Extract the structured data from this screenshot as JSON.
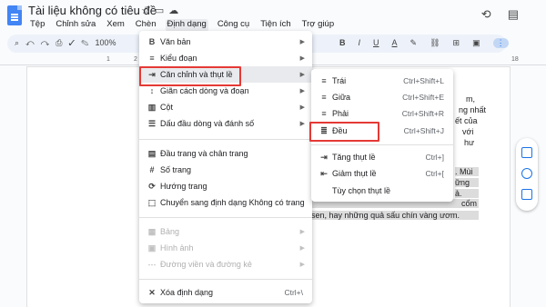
{
  "doc": {
    "title": "Tài liệu không có tiêu đề",
    "menus": [
      "Tệp",
      "Chỉnh sửa",
      "Xem",
      "Chèn",
      "Định dạng",
      "Công cụ",
      "Tiện ích",
      "Trợ giúp"
    ],
    "zoom": "100%"
  },
  "ruler": [
    "1",
    "2",
    "18"
  ],
  "body_text": {
    "l1": "m,",
    "l2": "ng nhất",
    "l3": "ết của",
    "l4": "với",
    "l5": "hư",
    "l6": ". Mùi",
    "l7": "ững",
    "l8": "ả.",
    "l9": "cốm",
    "l10": "sen, hay những quả sấu chín vàng ươm."
  },
  "format_menu": {
    "items": [
      {
        "label": "Văn bản",
        "icon": "bold-icon"
      },
      {
        "label": "Kiểu đoạn",
        "icon": "paragraph-style-icon"
      },
      {
        "label": "Căn chỉnh và thụt lề",
        "icon": "align-indent-icon"
      },
      {
        "label": "Giãn cách dòng và đoạn",
        "icon": "line-spacing-icon"
      },
      {
        "label": "Cột",
        "icon": "columns-icon"
      },
      {
        "label": "Dấu đầu dòng và đánh số",
        "icon": "bullets-icon"
      },
      {
        "label": "Đầu trang và chân trang",
        "icon": "header-footer-icon"
      },
      {
        "label": "Số trang",
        "icon": "page-number-icon"
      },
      {
        "label": "Hướng trang",
        "icon": "orientation-icon"
      },
      {
        "label": "Chuyển sang định dạng Không có trang",
        "icon": "pageless-icon"
      },
      {
        "label": "Bảng",
        "icon": "table-icon"
      },
      {
        "label": "Hình ảnh",
        "icon": "image-icon"
      },
      {
        "label": "Đường viền và đường kẻ",
        "icon": "borders-icon"
      },
      {
        "label": "Xóa định dạng",
        "icon": "clear-format-icon",
        "shortcut": "Ctrl+\\"
      }
    ]
  },
  "align_menu": {
    "items": [
      {
        "label": "Trái",
        "shortcut": "Ctrl+Shift+L"
      },
      {
        "label": "Giữa",
        "shortcut": "Ctrl+Shift+E"
      },
      {
        "label": "Phải",
        "shortcut": "Ctrl+Shift+R"
      },
      {
        "label": "Đều",
        "shortcut": "Ctrl+Shift+J"
      },
      {
        "label": "Tăng thụt lề",
        "shortcut": "Ctrl+]"
      },
      {
        "label": "Giảm thụt lề",
        "shortcut": "Ctrl+["
      },
      {
        "label": "Tùy chọn thụt lề",
        "shortcut": ""
      }
    ]
  },
  "colors": {
    "highlight_box": "#e53935",
    "accent": "#1a73e8"
  }
}
